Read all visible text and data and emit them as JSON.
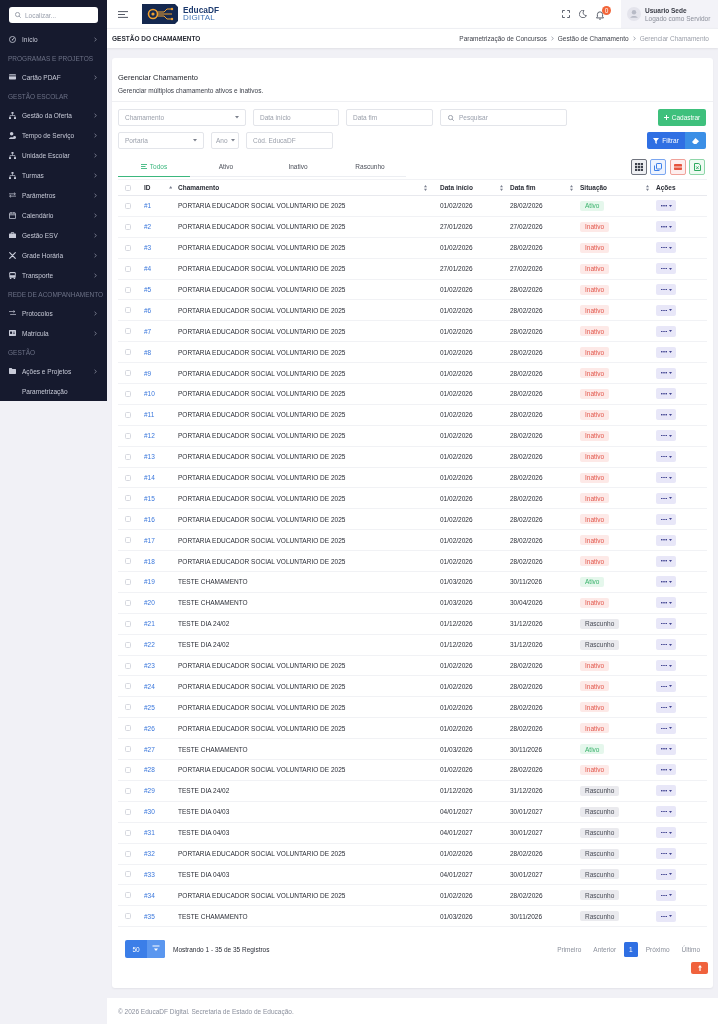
{
  "sidebar": {
    "search": {
      "placeholder": "Localizar..."
    },
    "sections": [
      {
        "items": [
          {
            "label": "Início",
            "submenu": true
          }
        ]
      },
      {
        "title": "PROGRAMAS E PROJETOS",
        "items": [
          {
            "label": "Cartão PDAF",
            "submenu": true
          }
        ]
      },
      {
        "title": "GESTÃO ESCOLAR",
        "items": [
          {
            "label": "Gestão da Oferta",
            "submenu": true
          },
          {
            "label": "Tempo de Serviço",
            "submenu": true
          },
          {
            "label": "Unidade Escolar",
            "submenu": true
          },
          {
            "label": "Turmas",
            "submenu": true
          },
          {
            "label": "Parâmetros",
            "submenu": true
          },
          {
            "label": "Calendário",
            "submenu": true
          },
          {
            "label": "Gestão ESV",
            "submenu": true
          },
          {
            "label": "Grade Horária",
            "submenu": true
          },
          {
            "label": "Transporte",
            "submenu": true
          }
        ]
      },
      {
        "title": "REDE DE ACOMPANHAMENTO",
        "items": [
          {
            "label": "Protocolos",
            "submenu": true
          },
          {
            "label": "Matrícula",
            "submenu": true
          }
        ]
      },
      {
        "title": "GESTÃO",
        "items": [
          {
            "label": "Ações e Projetos",
            "submenu": true
          },
          {
            "label": "Parametrização",
            "submenu": false
          }
        ]
      }
    ]
  },
  "header": {
    "brand": {
      "name": "EducaDF",
      "tagline": "DIGITAL"
    },
    "notification_count": "0",
    "user": {
      "name": "Usuario Sede",
      "role": "Logado como Servidor"
    }
  },
  "title_bar": {
    "title": "GESTÃO DO CHAMAMENTO",
    "breadcrumbs": [
      {
        "label": "Parametrização de Concursos",
        "current": false
      },
      {
        "label": "Gestão de Chamamento",
        "current": false
      },
      {
        "label": "Gerenciar Chamamento",
        "current": true
      }
    ]
  },
  "card": {
    "title": "Gerenciar Chamamento",
    "subtitle": "Gerenciar múltiplos chamamento ativos e inativos."
  },
  "filters": {
    "first_line": [
      {
        "kind": "select",
        "placeholder": "Chamamento"
      },
      {
        "kind": "date",
        "placeholder": "Data início"
      },
      {
        "kind": "date",
        "placeholder": "Data fim"
      },
      {
        "kind": "search",
        "placeholder": "Pesquisar"
      }
    ],
    "second_line": [
      {
        "kind": "select",
        "placeholder": "Portaria"
      },
      {
        "kind": "select",
        "placeholder": "Ano"
      },
      {
        "kind": "text",
        "placeholder": "Cód. EducaDF"
      }
    ],
    "create_button": "Cadastrar",
    "filter_button": "Filtrar"
  },
  "tabs": [
    {
      "label": "Todos",
      "selected": true
    },
    {
      "label": "Ativo",
      "selected": false
    },
    {
      "label": "Inativo",
      "selected": false
    },
    {
      "label": "Rascunho",
      "selected": false
    }
  ],
  "table": {
    "select_all": {
      "checked": false
    },
    "columns": [
      {
        "label": "ID",
        "sortable": true,
        "sorted": true
      },
      {
        "label": "Chamamento",
        "sortable": true,
        "sorted": false
      },
      {
        "label": "Data início",
        "sortable": true,
        "sorted": false
      },
      {
        "label": "Data fim",
        "sortable": true,
        "sorted": false
      },
      {
        "label": "Situação",
        "sortable": true,
        "sorted": false
      },
      {
        "label": "Ações",
        "sortable": false
      }
    ],
    "rows": [
      {
        "checked": false,
        "id": "#1",
        "name": "PORTARIA EDUCADOR SOCIAL VOLUNTARIO DE 2025",
        "start": "01/02/2026",
        "end": "28/02/2026",
        "status": {
          "label": "Ativo",
          "kind": "active"
        }
      },
      {
        "checked": false,
        "id": "#2",
        "name": "PORTARIA EDUCADOR SOCIAL VOLUNTARIO DE 2025",
        "start": "27/01/2026",
        "end": "27/02/2026",
        "status": {
          "label": "Inativo",
          "kind": "inactive"
        }
      },
      {
        "checked": false,
        "id": "#3",
        "name": "PORTARIA EDUCADOR SOCIAL VOLUNTARIO DE 2025",
        "start": "01/02/2026",
        "end": "28/02/2026",
        "status": {
          "label": "Inativo",
          "kind": "inactive"
        }
      },
      {
        "checked": false,
        "id": "#4",
        "name": "PORTARIA EDUCADOR SOCIAL VOLUNTARIO DE 2025",
        "start": "27/01/2026",
        "end": "27/02/2026",
        "status": {
          "label": "Inativo",
          "kind": "inactive"
        }
      },
      {
        "checked": false,
        "id": "#5",
        "name": "PORTARIA EDUCADOR SOCIAL VOLUNTARIO DE 2025",
        "start": "01/02/2026",
        "end": "28/02/2026",
        "status": {
          "label": "Inativo",
          "kind": "inactive"
        }
      },
      {
        "checked": false,
        "id": "#6",
        "name": "PORTARIA EDUCADOR SOCIAL VOLUNTARIO DE 2025",
        "start": "01/02/2026",
        "end": "28/02/2026",
        "status": {
          "label": "Inativo",
          "kind": "inactive"
        }
      },
      {
        "checked": false,
        "id": "#7",
        "name": "PORTARIA EDUCADOR SOCIAL VOLUNTARIO DE 2025",
        "start": "01/02/2026",
        "end": "28/02/2026",
        "status": {
          "label": "Inativo",
          "kind": "inactive"
        }
      },
      {
        "checked": false,
        "id": "#8",
        "name": "PORTARIA EDUCADOR SOCIAL VOLUNTARIO DE 2025",
        "start": "01/02/2026",
        "end": "28/02/2026",
        "status": {
          "label": "Inativo",
          "kind": "inactive"
        }
      },
      {
        "checked": false,
        "id": "#9",
        "name": "PORTARIA EDUCADOR SOCIAL VOLUNTARIO DE 2025",
        "start": "01/02/2026",
        "end": "28/02/2026",
        "status": {
          "label": "Inativo",
          "kind": "inactive"
        }
      },
      {
        "checked": false,
        "id": "#10",
        "name": "PORTARIA EDUCADOR SOCIAL VOLUNTARIO DE 2025",
        "start": "01/02/2026",
        "end": "28/02/2026",
        "status": {
          "label": "Inativo",
          "kind": "inactive"
        }
      },
      {
        "checked": false,
        "id": "#11",
        "name": "PORTARIA EDUCADOR SOCIAL VOLUNTARIO DE 2025",
        "start": "01/02/2026",
        "end": "28/02/2026",
        "status": {
          "label": "Inativo",
          "kind": "inactive"
        }
      },
      {
        "checked": false,
        "id": "#12",
        "name": "PORTARIA EDUCADOR SOCIAL VOLUNTARIO DE 2025",
        "start": "01/02/2026",
        "end": "28/02/2026",
        "status": {
          "label": "Inativo",
          "kind": "inactive"
        }
      },
      {
        "checked": false,
        "id": "#13",
        "name": "PORTARIA EDUCADOR SOCIAL VOLUNTARIO DE 2025",
        "start": "01/02/2026",
        "end": "28/02/2026",
        "status": {
          "label": "Inativo",
          "kind": "inactive"
        }
      },
      {
        "checked": false,
        "id": "#14",
        "name": "PORTARIA EDUCADOR SOCIAL VOLUNTARIO DE 2025",
        "start": "01/02/2026",
        "end": "28/02/2026",
        "status": {
          "label": "Inativo",
          "kind": "inactive"
        }
      },
      {
        "checked": false,
        "id": "#15",
        "name": "PORTARIA EDUCADOR SOCIAL VOLUNTARIO DE 2025",
        "start": "01/02/2026",
        "end": "28/02/2026",
        "status": {
          "label": "Inativo",
          "kind": "inactive"
        }
      },
      {
        "checked": false,
        "id": "#16",
        "name": "PORTARIA EDUCADOR SOCIAL VOLUNTARIO DE 2025",
        "start": "01/02/2026",
        "end": "28/02/2026",
        "status": {
          "label": "Inativo",
          "kind": "inactive"
        }
      },
      {
        "checked": false,
        "id": "#17",
        "name": "PORTARIA EDUCADOR SOCIAL VOLUNTARIO DE 2025",
        "start": "01/02/2026",
        "end": "28/02/2026",
        "status": {
          "label": "Inativo",
          "kind": "inactive"
        }
      },
      {
        "checked": false,
        "id": "#18",
        "name": "PORTARIA EDUCADOR SOCIAL VOLUNTARIO DE 2025",
        "start": "01/02/2026",
        "end": "28/02/2026",
        "status": {
          "label": "Inativo",
          "kind": "inactive"
        }
      },
      {
        "checked": false,
        "id": "#19",
        "name": "TESTE CHAMAMENTO",
        "start": "01/03/2026",
        "end": "30/11/2026",
        "status": {
          "label": "Ativo",
          "kind": "active"
        }
      },
      {
        "checked": false,
        "id": "#20",
        "name": "TESTE CHAMAMENTO",
        "start": "01/03/2026",
        "end": "30/04/2026",
        "status": {
          "label": "Inativo",
          "kind": "inactive"
        }
      },
      {
        "checked": false,
        "id": "#21",
        "name": "TESTE DIA 24/02",
        "start": "01/12/2026",
        "end": "31/12/2026",
        "status": {
          "label": "Rascunho",
          "kind": "draft"
        }
      },
      {
        "checked": false,
        "id": "#22",
        "name": "TESTE DIA 24/02",
        "start": "01/12/2026",
        "end": "31/12/2026",
        "status": {
          "label": "Rascunho",
          "kind": "draft"
        }
      },
      {
        "checked": false,
        "id": "#23",
        "name": "PORTARIA EDUCADOR SOCIAL VOLUNTARIO DE 2025",
        "start": "01/02/2026",
        "end": "28/02/2026",
        "status": {
          "label": "Inativo",
          "kind": "inactive"
        }
      },
      {
        "checked": false,
        "id": "#24",
        "name": "PORTARIA EDUCADOR SOCIAL VOLUNTARIO DE 2025",
        "start": "01/02/2026",
        "end": "28/02/2026",
        "status": {
          "label": "Inativo",
          "kind": "inactive"
        }
      },
      {
        "checked": false,
        "id": "#25",
        "name": "PORTARIA EDUCADOR SOCIAL VOLUNTARIO DE 2025",
        "start": "01/02/2026",
        "end": "28/02/2026",
        "status": {
          "label": "Inativo",
          "kind": "inactive"
        }
      },
      {
        "checked": false,
        "id": "#26",
        "name": "PORTARIA EDUCADOR SOCIAL VOLUNTARIO DE 2025",
        "start": "01/02/2026",
        "end": "28/02/2026",
        "status": {
          "label": "Inativo",
          "kind": "inactive"
        }
      },
      {
        "checked": false,
        "id": "#27",
        "name": "TESTE CHAMAMENTO",
        "start": "01/03/2026",
        "end": "30/11/2026",
        "status": {
          "label": "Ativo",
          "kind": "active"
        }
      },
      {
        "checked": false,
        "id": "#28",
        "name": "PORTARIA EDUCADOR SOCIAL VOLUNTARIO DE 2025",
        "start": "01/02/2026",
        "end": "28/02/2026",
        "status": {
          "label": "Inativo",
          "kind": "inactive"
        }
      },
      {
        "checked": false,
        "id": "#29",
        "name": "TESTE DIA 24/02",
        "start": "01/12/2026",
        "end": "31/12/2026",
        "status": {
          "label": "Rascunho",
          "kind": "draft"
        }
      },
      {
        "checked": false,
        "id": "#30",
        "name": "TESTE DIA 04/03",
        "start": "04/01/2027",
        "end": "30/01/2027",
        "status": {
          "label": "Rascunho",
          "kind": "draft"
        }
      },
      {
        "checked": false,
        "id": "#31",
        "name": "TESTE DIA 04/03",
        "start": "04/01/2027",
        "end": "30/01/2027",
        "status": {
          "label": "Rascunho",
          "kind": "draft"
        }
      },
      {
        "checked": false,
        "id": "#32",
        "name": "PORTARIA EDUCADOR SOCIAL VOLUNTARIO DE 2025",
        "start": "01/02/2026",
        "end": "28/02/2026",
        "status": {
          "label": "Rascunho",
          "kind": "draft"
        }
      },
      {
        "checked": false,
        "id": "#33",
        "name": "TESTE DIA 04/03",
        "start": "04/01/2027",
        "end": "30/01/2027",
        "status": {
          "label": "Rascunho",
          "kind": "draft"
        }
      },
      {
        "checked": false,
        "id": "#34",
        "name": "PORTARIA EDUCADOR SOCIAL VOLUNTARIO DE 2025",
        "start": "01/02/2026",
        "end": "28/02/2026",
        "status": {
          "label": "Rascunho",
          "kind": "draft"
        }
      },
      {
        "checked": false,
        "id": "#35",
        "name": "TESTE CHAMAMENTO",
        "start": "01/03/2026",
        "end": "30/11/2026",
        "status": {
          "label": "Rascunho",
          "kind": "draft"
        }
      }
    ]
  },
  "pagination": {
    "page_size": "50",
    "summary": "Mostrando 1 - 35 de 35 Registros",
    "pages": [
      {
        "label": "Primeiro",
        "selected": false
      },
      {
        "label": "Anterior",
        "selected": false
      },
      {
        "label": "1",
        "selected": true
      },
      {
        "label": "Próximo",
        "selected": false
      },
      {
        "label": "Último",
        "selected": false
      }
    ]
  },
  "footer": {
    "text": "© 2026 EducaDF Digital. Secretaria de Estado de Educação."
  }
}
